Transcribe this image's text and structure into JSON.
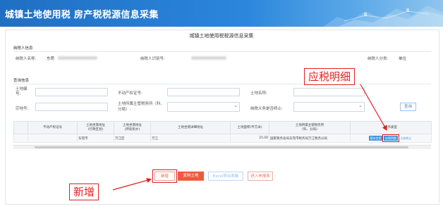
{
  "header": {
    "title": "城镇土地使用税 房产税税源信息采集"
  },
  "form": {
    "title": "城镇土地使用税税源信息采集"
  },
  "taxpayer": {
    "section_title": "纳税人信息",
    "name_label": "纳税人名称:",
    "name_value": "东莞",
    "id_label": "纳税人识别号:",
    "category_label": "纳税人分类:",
    "category_value": "单位"
  },
  "query": {
    "section_title": "查询信息",
    "land_no_label": "土地编号:",
    "property_cert_label": "不动产权证号:",
    "land_name_label": "土地名称:",
    "parcel_no_label": "宗地号:",
    "district_label": "土地所属主管税务所（科、分局）:",
    "obligation_end_label": "纳税义务是否终止:",
    "query_button": "查询"
  },
  "table": {
    "headers": [
      "",
      "不动产权证号",
      "土地坐落地址\n(行政区划)",
      "土地坐落地址\n(所处街乡)",
      "土地坐落详细地址",
      "土地面积(平方米)",
      "土地所属主管税务所\n(科、分局)",
      "操作类型"
    ],
    "rows": [
      {
        "cert_no": "",
        "admin_area": "东莞市",
        "street": "万江区",
        "address": "万江",
        "area": "25.00",
        "office": "国家税务总局东莞市税务局万江税务分局",
        "ops": [
          "基本信息",
          "应税明细",
          "义务终止"
        ]
      }
    ]
  },
  "buttons": {
    "add": "新增",
    "copy_land": "复制土地",
    "excel": "Excel导出表格",
    "history": "进入申报表"
  },
  "annotations": {
    "tax_detail_callout": "应税明细",
    "add_callout": "新增"
  },
  "colors": {
    "header_blue": "#1f6fc3",
    "accent_orange": "#f05a3c",
    "annotation_red": "#e02020",
    "link_blue": "#3b94e0"
  }
}
